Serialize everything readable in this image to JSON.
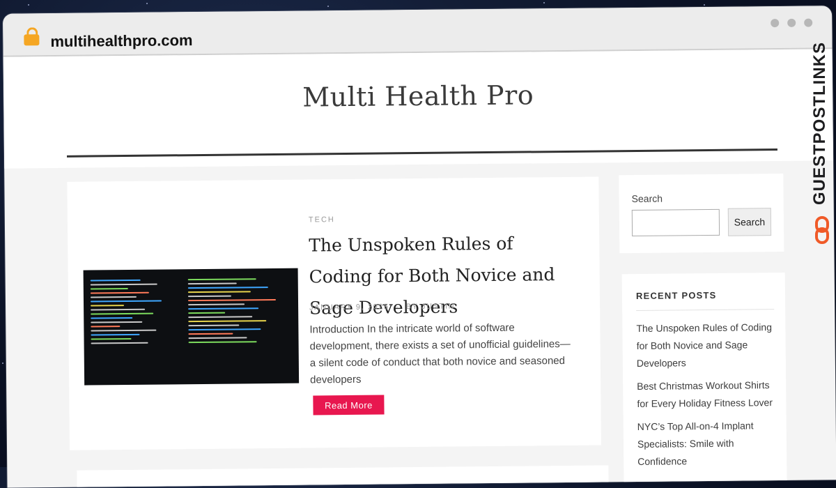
{
  "browser": {
    "url": "multihealthpro.com"
  },
  "site": {
    "title": "Multi Health Pro"
  },
  "article": {
    "category": "TECH",
    "title": "The Unspoken Rules of Coding for Both Novice and Sage Developers",
    "date": "JANUARY 9, 2025",
    "separator": "·",
    "author": "BY JUSTIN",
    "excerpt": "Introduction In the intricate world of software development, there exists a set of unofficial guidelines—a silent code of conduct that both novice and seasoned developers",
    "read_more": "Read More"
  },
  "search": {
    "label": "Search",
    "placeholder": "",
    "button": "Search"
  },
  "recent_posts": {
    "title": "RECENT POSTS",
    "items": [
      "The Unspoken Rules of Coding for Both Novice and Sage Developers",
      "Best Christmas Workout Shirts for Every Holiday Fitness Lover",
      "NYC’s Top All-on-4 Implant Specialists: Smile with Confidence"
    ]
  },
  "watermark": {
    "text": "GUESTPOSTLINKS"
  },
  "colors": {
    "accent": "#e8174f",
    "lock": "#f5a623",
    "watermark_logo": "#f05a28"
  }
}
